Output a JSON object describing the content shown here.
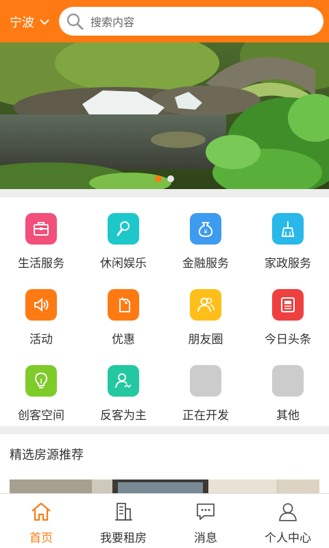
{
  "header": {
    "city": "宁波",
    "search_placeholder": "搜索内容"
  },
  "banner": {
    "slides": 2,
    "active_slide": 0
  },
  "grid": [
    {
      "label": "生活服务",
      "icon": "briefcase-icon",
      "color": "#f24f7b"
    },
    {
      "label": "休闲娱乐",
      "icon": "microphone-icon",
      "color": "#1ec7c9"
    },
    {
      "label": "金融服务",
      "icon": "money-bag-icon",
      "color": "#3d9bf0"
    },
    {
      "label": "家政服务",
      "icon": "broom-icon",
      "color": "#28b8ea"
    },
    {
      "label": "活动",
      "icon": "speaker-icon",
      "color": "#ff7a12"
    },
    {
      "label": "优惠",
      "icon": "tag-icon",
      "color": "#ff7a12"
    },
    {
      "label": "朋友圈",
      "icon": "friends-icon",
      "color": "#ffbf1a"
    },
    {
      "label": "今日头条",
      "icon": "newspaper-icon",
      "color": "#ef4040"
    },
    {
      "label": "创客空间",
      "icon": "lightbulb-icon",
      "color": "#7ecb2a"
    },
    {
      "label": "反客为主",
      "icon": "user-switch-icon",
      "color": "#23c7a0"
    },
    {
      "label": "正在开发",
      "icon": "placeholder-icon",
      "color": "#cccccc"
    },
    {
      "label": "其他",
      "icon": "placeholder-icon",
      "color": "#cccccc"
    }
  ],
  "section": {
    "title": "精选房源推荐"
  },
  "tabs": [
    {
      "label": "首页",
      "icon": "home-icon",
      "active": true
    },
    {
      "label": "我要租房",
      "icon": "building-icon",
      "active": false
    },
    {
      "label": "消息",
      "icon": "message-icon",
      "active": false
    },
    {
      "label": "个人中心",
      "icon": "person-icon",
      "active": false
    }
  ],
  "colors": {
    "brand": "#ff7a12",
    "tab_inactive": "#333333",
    "divider": "#eeeeee"
  }
}
